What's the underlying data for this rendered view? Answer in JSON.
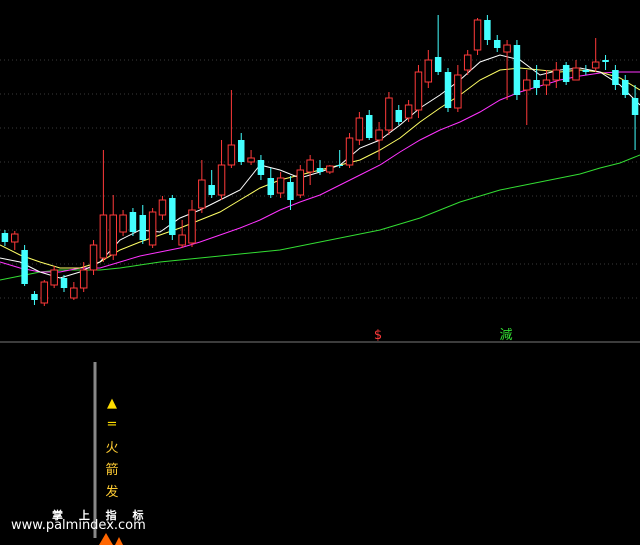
{
  "watermark": {
    "cn": "掌 上 指 标",
    "url": "www.palmindex.com"
  },
  "indicator_labels": [
    "▲",
    "=",
    "火",
    "箭",
    "发"
  ],
  "signal_labels": [
    "$",
    "減"
  ],
  "colors": {
    "up": "#ff3a3a",
    "down": "#43ffff",
    "ma_short": "#ffffff",
    "ma_mid": "#ffff66",
    "ma_long": "#ff33ff",
    "ma_vlong": "#33dd33",
    "signal_sell": "#ff3a3a",
    "signal_reduce": "#33dd33",
    "indicator_text": "#ffcc33",
    "indicator_bar": "#ff6600"
  },
  "chart_data": {
    "type": "candlestick",
    "title": "",
    "xlabel": "",
    "ylabel": "",
    "grid": true,
    "candles": [
      {
        "o": 233,
        "c": 242,
        "h": 230,
        "l": 246
      },
      {
        "o": 242,
        "c": 234,
        "h": 231,
        "l": 250
      },
      {
        "o": 250,
        "c": 284,
        "h": 245,
        "l": 286
      },
      {
        "o": 294,
        "c": 300,
        "h": 291,
        "l": 305
      },
      {
        "o": 303,
        "c": 282,
        "h": 280,
        "l": 306
      },
      {
        "o": 285,
        "c": 270,
        "h": 266,
        "l": 288
      },
      {
        "o": 278,
        "c": 288,
        "h": 275,
        "l": 292
      },
      {
        "o": 298,
        "c": 288,
        "h": 282,
        "l": 300
      },
      {
        "o": 288,
        "c": 270,
        "h": 262,
        "l": 292
      },
      {
        "o": 270,
        "c": 245,
        "h": 240,
        "l": 275
      },
      {
        "o": 258,
        "c": 215,
        "h": 150,
        "l": 262
      },
      {
        "o": 255,
        "c": 215,
        "h": 195,
        "l": 260
      },
      {
        "o": 232,
        "c": 215,
        "h": 210,
        "l": 236
      },
      {
        "o": 212,
        "c": 232,
        "h": 208,
        "l": 236
      },
      {
        "o": 215,
        "c": 240,
        "h": 205,
        "l": 244
      },
      {
        "o": 245,
        "c": 212,
        "h": 208,
        "l": 248
      },
      {
        "o": 215,
        "c": 200,
        "h": 196,
        "l": 220
      },
      {
        "o": 198,
        "c": 235,
        "h": 195,
        "l": 240
      },
      {
        "o": 245,
        "c": 235,
        "h": 220,
        "l": 248
      },
      {
        "o": 243,
        "c": 210,
        "h": 200,
        "l": 247
      },
      {
        "o": 208,
        "c": 180,
        "h": 160,
        "l": 213
      },
      {
        "o": 185,
        "c": 195,
        "h": 170,
        "l": 198
      },
      {
        "o": 195,
        "c": 165,
        "h": 140,
        "l": 200
      },
      {
        "o": 165,
        "c": 145,
        "h": 90,
        "l": 168
      },
      {
        "o": 140,
        "c": 162,
        "h": 133,
        "l": 165
      },
      {
        "o": 162,
        "c": 158,
        "h": 150,
        "l": 165
      },
      {
        "o": 160,
        "c": 175,
        "h": 155,
        "l": 180
      },
      {
        "o": 178,
        "c": 195,
        "h": 168,
        "l": 198
      },
      {
        "o": 193,
        "c": 178,
        "h": 172,
        "l": 198
      },
      {
        "o": 182,
        "c": 200,
        "h": 176,
        "l": 210
      },
      {
        "o": 195,
        "c": 170,
        "h": 165,
        "l": 198
      },
      {
        "o": 172,
        "c": 160,
        "h": 155,
        "l": 185
      },
      {
        "o": 168,
        "c": 172,
        "h": 160,
        "l": 175
      },
      {
        "o": 172,
        "c": 166,
        "h": 165,
        "l": 174
      },
      {
        "o": 165,
        "c": 165,
        "h": 150,
        "l": 168
      },
      {
        "o": 165,
        "c": 138,
        "h": 133,
        "l": 168
      },
      {
        "o": 140,
        "c": 118,
        "h": 112,
        "l": 145
      },
      {
        "o": 115,
        "c": 138,
        "h": 110,
        "l": 140
      },
      {
        "o": 140,
        "c": 130,
        "h": 122,
        "l": 160
      },
      {
        "o": 130,
        "c": 98,
        "h": 92,
        "l": 135
      },
      {
        "o": 110,
        "c": 122,
        "h": 105,
        "l": 125
      },
      {
        "o": 118,
        "c": 105,
        "h": 100,
        "l": 122
      },
      {
        "o": 110,
        "c": 72,
        "h": 65,
        "l": 118
      },
      {
        "o": 82,
        "c": 60,
        "h": 50,
        "l": 88
      },
      {
        "o": 57,
        "c": 72,
        "h": 15,
        "l": 75
      },
      {
        "o": 72,
        "c": 108,
        "h": 68,
        "l": 112
      },
      {
        "o": 108,
        "c": 75,
        "h": 65,
        "l": 112
      },
      {
        "o": 70,
        "c": 55,
        "h": 50,
        "l": 75
      },
      {
        "o": 50,
        "c": 20,
        "h": 18,
        "l": 55
      },
      {
        "o": 20,
        "c": 40,
        "h": 15,
        "l": 45
      },
      {
        "o": 40,
        "c": 48,
        "h": 35,
        "l": 52
      },
      {
        "o": 52,
        "c": 45,
        "h": 40,
        "l": 100
      },
      {
        "o": 45,
        "c": 95,
        "h": 40,
        "l": 100
      },
      {
        "o": 90,
        "c": 80,
        "h": 70,
        "l": 125
      },
      {
        "o": 80,
        "c": 88,
        "h": 65,
        "l": 95
      },
      {
        "o": 85,
        "c": 80,
        "h": 70,
        "l": 95
      },
      {
        "o": 80,
        "c": 70,
        "h": 62,
        "l": 88
      },
      {
        "o": 65,
        "c": 82,
        "h": 62,
        "l": 85
      },
      {
        "o": 80,
        "c": 68,
        "h": 60,
        "l": 78
      },
      {
        "o": 70,
        "c": 72,
        "h": 65,
        "l": 75
      },
      {
        "o": 68,
        "c": 62,
        "h": 38,
        "l": 72
      },
      {
        "o": 60,
        "c": 62,
        "h": 55,
        "l": 70
      },
      {
        "o": 70,
        "c": 85,
        "h": 65,
        "l": 90
      },
      {
        "o": 80,
        "c": 95,
        "h": 75,
        "l": 98
      },
      {
        "o": 98,
        "c": 115,
        "h": 85,
        "l": 150
      }
    ],
    "ma_short": [
      [
        0,
        258
      ],
      [
        20,
        262
      ],
      [
        40,
        272
      ],
      [
        60,
        278
      ],
      [
        80,
        272
      ],
      [
        100,
        262
      ],
      [
        120,
        240
      ],
      [
        140,
        230
      ],
      [
        160,
        232
      ],
      [
        180,
        218
      ],
      [
        200,
        210
      ],
      [
        220,
        200
      ],
      [
        240,
        190
      ],
      [
        260,
        165
      ],
      [
        280,
        170
      ],
      [
        300,
        178
      ],
      [
        320,
        172
      ],
      [
        340,
        165
      ],
      [
        360,
        148
      ],
      [
        380,
        140
      ],
      [
        400,
        125
      ],
      [
        420,
        108
      ],
      [
        440,
        95
      ],
      [
        460,
        80
      ],
      [
        480,
        62
      ],
      [
        500,
        55
      ],
      [
        520,
        60
      ],
      [
        540,
        75
      ],
      [
        560,
        70
      ],
      [
        580,
        68
      ],
      [
        600,
        72
      ],
      [
        620,
        85
      ],
      [
        640,
        105
      ]
    ],
    "ma_mid": [
      [
        0,
        245
      ],
      [
        20,
        255
      ],
      [
        40,
        262
      ],
      [
        60,
        268
      ],
      [
        80,
        268
      ],
      [
        100,
        262
      ],
      [
        120,
        250
      ],
      [
        140,
        242
      ],
      [
        160,
        235
      ],
      [
        180,
        228
      ],
      [
        200,
        220
      ],
      [
        220,
        212
      ],
      [
        240,
        200
      ],
      [
        260,
        188
      ],
      [
        280,
        180
      ],
      [
        300,
        175
      ],
      [
        320,
        170
      ],
      [
        340,
        165
      ],
      [
        360,
        160
      ],
      [
        380,
        150
      ],
      [
        400,
        138
      ],
      [
        420,
        122
      ],
      [
        440,
        108
      ],
      [
        460,
        95
      ],
      [
        480,
        80
      ],
      [
        500,
        70
      ],
      [
        520,
        68
      ],
      [
        540,
        70
      ],
      [
        560,
        72
      ],
      [
        580,
        70
      ],
      [
        600,
        72
      ],
      [
        620,
        78
      ],
      [
        640,
        90
      ]
    ],
    "ma_long": [
      [
        0,
        262
      ],
      [
        20,
        268
      ],
      [
        40,
        272
      ],
      [
        60,
        272
      ],
      [
        80,
        268
      ],
      [
        100,
        268
      ],
      [
        120,
        262
      ],
      [
        140,
        256
      ],
      [
        160,
        252
      ],
      [
        180,
        248
      ],
      [
        200,
        242
      ],
      [
        220,
        235
      ],
      [
        240,
        228
      ],
      [
        260,
        220
      ],
      [
        280,
        210
      ],
      [
        300,
        202
      ],
      [
        320,
        195
      ],
      [
        340,
        185
      ],
      [
        360,
        175
      ],
      [
        380,
        165
      ],
      [
        400,
        152
      ],
      [
        420,
        140
      ],
      [
        440,
        130
      ],
      [
        460,
        122
      ],
      [
        480,
        112
      ],
      [
        500,
        100
      ],
      [
        520,
        92
      ],
      [
        540,
        86
      ],
      [
        560,
        80
      ],
      [
        580,
        76
      ],
      [
        600,
        73
      ],
      [
        620,
        72
      ],
      [
        640,
        72
      ]
    ],
    "ma_vlong": [
      [
        0,
        280
      ],
      [
        20,
        276
      ],
      [
        40,
        272
      ],
      [
        60,
        270
      ],
      [
        80,
        270
      ],
      [
        100,
        270
      ],
      [
        120,
        268
      ],
      [
        140,
        265
      ],
      [
        160,
        262
      ],
      [
        180,
        260
      ],
      [
        200,
        258
      ],
      [
        220,
        256
      ],
      [
        240,
        254
      ],
      [
        260,
        252
      ],
      [
        280,
        250
      ],
      [
        300,
        246
      ],
      [
        320,
        242
      ],
      [
        340,
        238
      ],
      [
        360,
        234
      ],
      [
        380,
        230
      ],
      [
        400,
        224
      ],
      [
        420,
        218
      ],
      [
        440,
        210
      ],
      [
        460,
        202
      ],
      [
        480,
        196
      ],
      [
        500,
        190
      ],
      [
        520,
        186
      ],
      [
        540,
        182
      ],
      [
        560,
        178
      ],
      [
        580,
        174
      ],
      [
        600,
        168
      ],
      [
        620,
        163
      ],
      [
        640,
        155
      ]
    ],
    "indicator": {
      "bar_level": 1.0
    }
  }
}
